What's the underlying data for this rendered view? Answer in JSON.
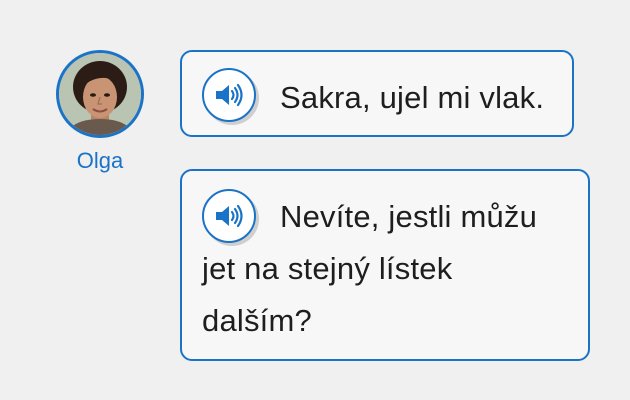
{
  "speaker": {
    "name": "Olga"
  },
  "messages": [
    {
      "audio_icon": "speaker-volume-icon",
      "lines": [
        "Sakra, ujel mi vlak."
      ]
    },
    {
      "audio_icon": "speaker-volume-icon",
      "lines": [
        "Nevíte, jestli můžu",
        "jet na stejný lístek",
        "dalším?"
      ]
    }
  ],
  "colors": {
    "accent": "#1a73c7",
    "bubble_bg": "#f7f7f7",
    "page_bg": "#f0f0f0",
    "text": "#1e1e1e"
  }
}
